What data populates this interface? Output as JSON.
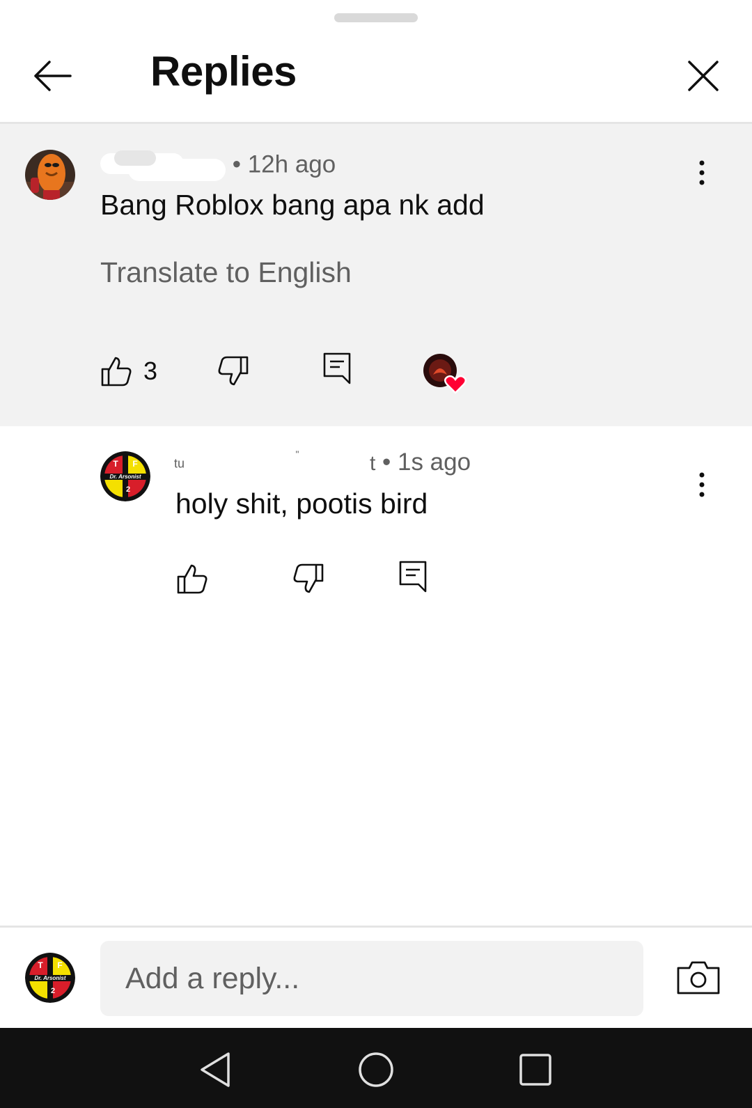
{
  "header": {
    "title": "Replies"
  },
  "parent_comment": {
    "time": "• 12h ago",
    "text": "Bang Roblox bang apa nk add",
    "translate_label": "Translate to English",
    "like_count": "3"
  },
  "reply_comment": {
    "username_fragments": [
      "tu",
      "\"",
      "t"
    ],
    "time": "• 1s ago",
    "text": "holy shit, pootis bird"
  },
  "badge": {
    "logo_lines": [
      "T",
      "F",
      "Dr. Arsonist",
      "2"
    ]
  },
  "composer": {
    "placeholder": "Add a reply..."
  },
  "colors": {
    "heart": "#ff0033",
    "panel": "#f2f2f2",
    "secondary_text": "#606060"
  }
}
